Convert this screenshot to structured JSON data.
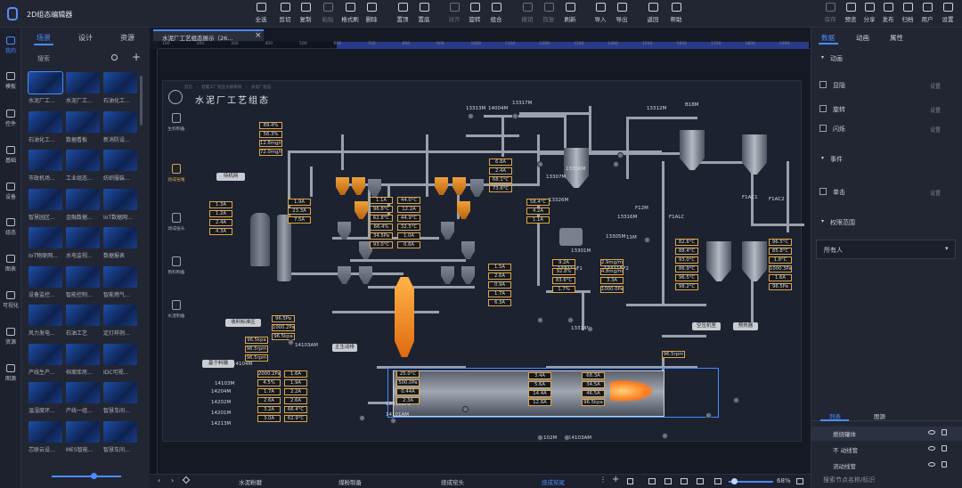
{
  "app": {
    "title": "2D组态编辑器"
  },
  "toolbar": {
    "left": [
      "全选",
      "剪切",
      "复制",
      "粘贴",
      "格式刷",
      "删除",
      "置顶",
      "置底",
      "对齐",
      "旋转",
      "组合",
      "撤销",
      "恢复",
      "刷新",
      "导入",
      "导出",
      "返回",
      "帮助"
    ],
    "right": [
      "保存",
      "预览",
      "分享",
      "发布",
      "归档",
      "用户",
      "设置"
    ]
  },
  "rail": [
    "我的",
    "模板",
    "控件",
    "基础",
    "设备",
    "组态",
    "图表",
    "可视化",
    "资源",
    "图源"
  ],
  "library": {
    "tabs": [
      "场景",
      "设计",
      "资源"
    ],
    "search_placeholder": "搜索",
    "items": [
      "水泥厂工...",
      "水泥厂工...",
      "石油化工...",
      "石油化工...",
      "数据看板",
      "新消防设...",
      "市政机场...",
      "工业组态...",
      "纺织服装...",
      "智慧园区...",
      "金融数据...",
      "IoT数据网...",
      "IoT物联网...",
      "水电监视...",
      "数据报表",
      "设备监控...",
      "智能控制...",
      "智能燃气...",
      "风力发电...",
      "石油工艺",
      "定灯样例...",
      "产线生产...",
      "档案库房...",
      "IDC可视...",
      "温湿度环...",
      "产线一组...",
      "智慧车间...",
      "芯联云设...",
      "MES智能...",
      "智慧车间..."
    ]
  },
  "canvas": {
    "doc_tab": "水泥厂工艺组态展示（26...",
    "ruler": [
      "100",
      "200",
      "300",
      "400",
      "500",
      "600",
      "700",
      "800",
      "900",
      "1000",
      "1100",
      "1200",
      "1300",
      "1400",
      "1500",
      "1600",
      "1700",
      "1800",
      "1900"
    ],
    "breadcrumb": "首页　·　智能工厂组态大屏系统　·　水泥厂组态",
    "scene_title": "水泥厂工艺组态",
    "nav": [
      "生料制备",
      "烧成窑尾",
      "烧成窑头",
      "熟料制备",
      "水泥制备"
    ],
    "zoom": "68%"
  },
  "scene": {
    "labels": [
      "13313M",
      "14004M",
      "13317M",
      "13306M",
      "13307M",
      "13326M",
      "13305M",
      "13316M",
      "13301M",
      "13311AF1",
      "13311BF2",
      "13314M",
      "14103AM",
      "14103M",
      "14104M",
      "14204M",
      "14202M",
      "14201M",
      "14213M",
      "13312M",
      "B18M",
      "F1ALC",
      "F1AC1",
      "F1AC2",
      "F12M",
      "11M",
      "14101AM",
      "14102M",
      "14103AM",
      "13311BF1"
    ],
    "buttons": [
      "待机网",
      "收料标准区",
      "基于料输",
      "主生动排",
      "空压机室",
      "预热器",
      "生料均化",
      "烟囱",
      "采集器"
    ],
    "values": [
      "1.3A",
      "1.2A",
      "2.4A",
      "4.3A",
      "89.4%",
      "56.3%",
      "12.8mg/m³",
      "72.0mg/m³",
      "1.9A",
      "23.3A",
      "7.5A",
      "1.1A",
      "96.8°C",
      "62.8°C",
      "66.4%",
      "34.5Pa",
      "93.0°C",
      "44.0°C",
      "12.2A",
      "44.9°C",
      "32.5°C",
      "1.0A",
      "0.8A",
      "6.8A",
      "2.4A",
      "68.1°C",
      "73.6°C",
      "58.4°C",
      "4.2A",
      "1.1A",
      "1.5A",
      "2.6A",
      "0.9A",
      "1.7A",
      "6.3A",
      "9.2A",
      "92.8%",
      "83.6°C",
      "1.7%",
      "2.9mg/m³",
      "4.8mg/m³",
      "3.3A",
      "1000.0Pa",
      "82.6°C",
      "88.4°C",
      "93.0°C",
      "86.9°C",
      "96.5°C",
      "98.2°C",
      "96.5°C",
      "85.8°C",
      "1.8°C",
      "1000.3Pa",
      "1.6A",
      "96.5Pa",
      "96.5Pa",
      "1000.2Pa",
      "96.5kpa",
      "96.5kpa",
      "96.5rpm",
      "96.5rpm",
      "2000.2Pa",
      "4.5%",
      "1.7A",
      "2.6A",
      "3.2A",
      "3.0A",
      "1.6A",
      "1.9A",
      "2.2A",
      "2.6A",
      "66.4°C",
      "62.9°C",
      "25.0°C",
      "500.0Pa",
      "0.44A",
      "2.3A",
      "3.4A",
      "5.6A",
      "14.4A",
      "12.8A",
      "68.3A",
      "34.5A",
      "46.5A",
      "96.5kpa",
      "96.5rpm"
    ]
  },
  "rightpanel": {
    "tabs": [
      "数据",
      "动画",
      "属性"
    ],
    "section_anim": "动画",
    "anims": [
      "显隐",
      "旋转",
      "闪烁"
    ],
    "setting": "设置",
    "section_event": "事件",
    "events": [
      "单击"
    ],
    "section_perm": "权限范围",
    "perm_value": "所有人",
    "layer_tabs": [
      "列表",
      "图源"
    ],
    "layers": [
      "燃烧罐体",
      "不 动线管",
      "流动线管"
    ],
    "layer_search": "搜索节点名称/标识"
  },
  "bottom_tabs": [
    "水泥粉磨",
    "煤粉制备",
    "烧成窑头",
    "烧成窑尾"
  ]
}
